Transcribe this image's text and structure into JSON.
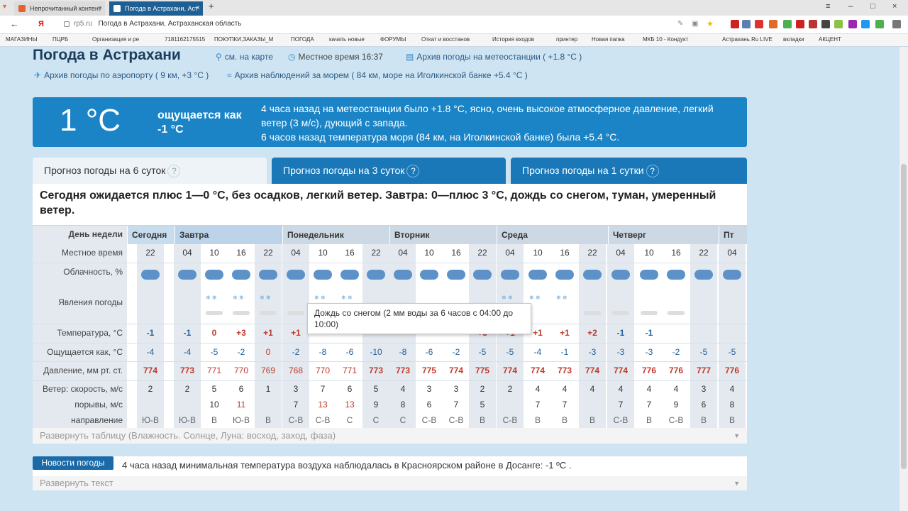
{
  "browser": {
    "tab1": "Непрочитанный контент",
    "tab2": "Погода в Астрахани, Аст",
    "url_domain": "rp5.ru",
    "url_title": "Погода в Астрахани, Астраханская область",
    "bookmarks": [
      "МАГАЗИНЫ",
      "ПЦРБ",
      "Организация и ре",
      "7181162175515",
      "ПОКУПКИ,ЗАКАЗЫ_М",
      "ПОГОДА",
      "качать новые",
      "ФОРУМЫ",
      "Откат и восстанов",
      "История входов",
      "принтер",
      "Новая папка",
      "МКБ 10 - Кондукт",
      "Астрахань.Ru LIVE",
      "вкладки",
      "АКЦЕНТ"
    ]
  },
  "header": {
    "title": "Погода в Астрахани",
    "map": "см. на карте",
    "localtime": "Местное время  16:37",
    "archive_station": "Архив погоды на метеостанции ( +1.8 °C )",
    "archive_airport": "Архив погоды по аэропорту ( 9 км, +3 °C )",
    "archive_sea": "Архив наблюдений за морем ( 84 км, море на Иголкинской банке +5.4 °C )"
  },
  "now": {
    "temp": "1 °C",
    "feels": "ощущается как -1 °C",
    "text1": "4 часа назад на метеостанции было +1.8 °C, ясно, очень высокое атмосферное давление, легкий ветер (3 м/с), дующий с запада.",
    "text2": "6 часов назад температура моря (84 км, на Иголкинской банке) была +5.4 °C."
  },
  "tabs": [
    "Прогноз погоды на 6 суток",
    "Прогноз погоды на 3 суток",
    "Прогноз погоды на 1 сутки"
  ],
  "summary": "Сегодня ожидается плюс 1—0 °C, без осадков, легкий ветер. Завтра: 0—плюс 3 °C, дождь со снегом, туман, умеренный ветер.",
  "table": {
    "labels": [
      "День недели",
      "Местное время",
      "Облачность, %",
      "Явления погоды",
      "Температура, °C",
      "Ощущается как, °C",
      "Давление, мм рт. ст.",
      "Ветер: скорость, м/с",
      "порывы, м/с",
      "направление"
    ],
    "days": [
      "Сегодня",
      "Завтра",
      "Понедельник",
      "Вторник",
      "Среда",
      "Четверг",
      "Пт"
    ],
    "hours": [
      "22",
      "04",
      "10",
      "16",
      "22",
      "04",
      "10",
      "16",
      "22",
      "04",
      "10",
      "16",
      "22",
      "04",
      "10",
      "16",
      "22",
      "04",
      "10",
      "16",
      "22",
      "04"
    ],
    "temp": [
      "-1",
      "-1",
      "0",
      "+3",
      "+1",
      "+1",
      "",
      "",
      "",
      "",
      "",
      "+3",
      "+1",
      "+1",
      "+1",
      "+2",
      "-1",
      "-1"
    ],
    "temp_full": [
      "-1",
      "-1",
      "0",
      "+3",
      "+1",
      "+1",
      "",
      "",
      "",
      "",
      "",
      "",
      "+3",
      "+1",
      "+1",
      "+1",
      "+2",
      "-1",
      "-1"
    ],
    "feels": [
      "-4",
      "-4",
      "-5",
      "-2",
      "0",
      "-2",
      "-8",
      "-6",
      "-10",
      "-8",
      "-6",
      "-2",
      "-5",
      "-5",
      "-4",
      "-1",
      "-3",
      "-3",
      "-3",
      "-2",
      "-5",
      "-5"
    ],
    "pressure": [
      "774",
      "773",
      "771",
      "770",
      "769",
      "768",
      "770",
      "771",
      "773",
      "773",
      "775",
      "774",
      "775",
      "774",
      "774",
      "773",
      "774",
      "774",
      "776",
      "776",
      "777",
      "776"
    ],
    "wind": [
      "2",
      "2",
      "5",
      "6",
      "1",
      "3",
      "7",
      "6",
      "5",
      "4",
      "3",
      "3",
      "2",
      "2",
      "4",
      "4",
      "4",
      "4",
      "4",
      "4",
      "3",
      "4"
    ],
    "gusts": [
      "",
      "",
      "10",
      "11",
      "",
      "7",
      "13",
      "13",
      "9",
      "8",
      "6",
      "7",
      "5",
      "",
      "7",
      "7",
      "",
      "7",
      "7",
      "9",
      "6",
      "8"
    ],
    "dir": [
      "Ю-В",
      "Ю-В",
      "В",
      "Ю-В",
      "В",
      "С-В",
      "С-В",
      "С",
      "С",
      "С",
      "С-В",
      "С-В",
      "В",
      "С-В",
      "В",
      "В",
      "В",
      "С-В",
      "В",
      "С-В",
      "В",
      "В"
    ]
  },
  "tooltip": "Дождь со снегом (2 мм воды за 6 часов с 04:00 до 10:00)",
  "expand_table": "Развернуть таблицу (Влажность. Солнце, Луна: восход, заход, фаза)",
  "news": {
    "button": "Новости погоды",
    "text": "4 часа назад минимальная температура воздуха наблюдалась в Красноярском районе в Досанге: -1 ºC .",
    "expand": "Развернуть текст"
  }
}
